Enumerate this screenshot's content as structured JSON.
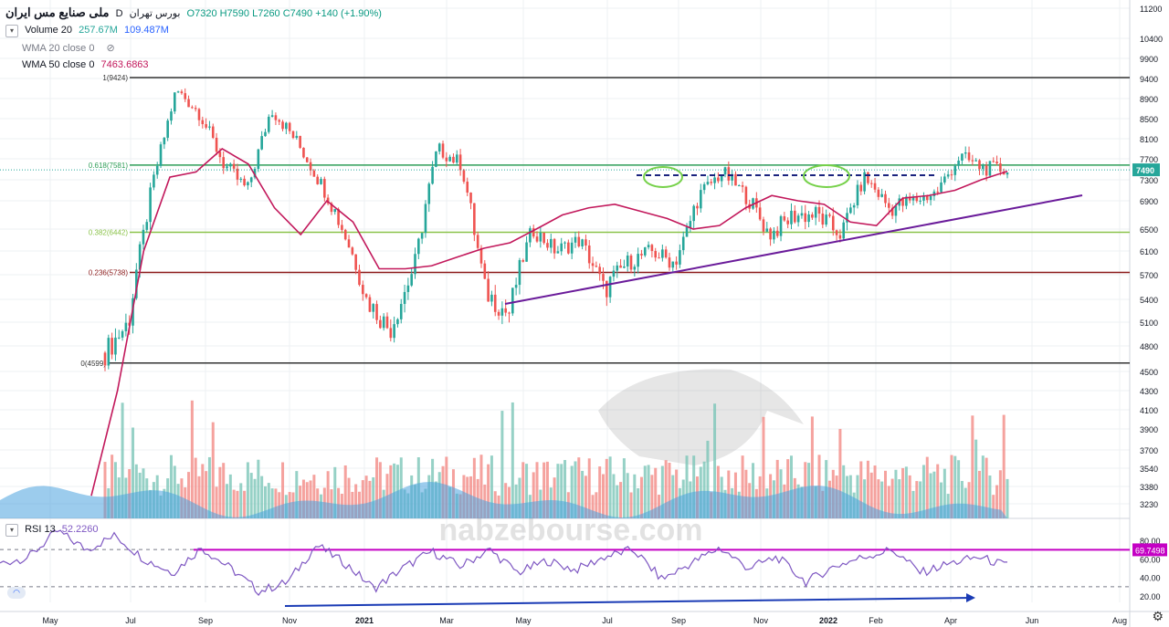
{
  "header": {
    "symbol": "ملی صنایع مس ایران",
    "interval": "D",
    "exchange": "بورس تهران",
    "ohlc": "O7320 H7590 L7260 C7490 +140 (+1.90%)"
  },
  "indicators": {
    "volume": {
      "label": "Volume 20",
      "v1": "257.67M",
      "v2": "109.487M"
    },
    "wma20": {
      "label": "WMA 20 close 0"
    },
    "wma50": {
      "label": "WMA 50 close 0",
      "value": "7463.6863"
    },
    "rsi": {
      "label": "RSI 13",
      "value": "52.2260"
    }
  },
  "watermark": {
    "text": "nabzebourse.com"
  },
  "colors": {
    "up": "#26a69a",
    "down": "#ef5350",
    "wma": "#c2185b",
    "fib_1": "#333333",
    "fib_618": "#2e9e57",
    "fib_382": "#8bc34a",
    "fib_236": "#8b1a1a",
    "fib_0": "#333333",
    "trend": "#6a1b9a",
    "rsi": "#7e57c2",
    "rsi_level": "#c400c4",
    "rsi_div": "#1a3bb5"
  },
  "chart_data": {
    "type": "line",
    "title": "ملی صنایع مس ایران · D · بورس تهران",
    "x": [
      "May",
      "Jul",
      "Sep",
      "Nov",
      "2021",
      "Mar",
      "May",
      "Jul",
      "Sep",
      "Nov",
      "2022",
      "Feb",
      "Apr",
      "Jun",
      "Aug"
    ],
    "y_ticks": [
      11200,
      10400,
      9900,
      9400,
      8900,
      8500,
      8100,
      7700,
      7300,
      6900,
      6500,
      6100,
      5700,
      5400,
      5100,
      4800,
      4500,
      4300,
      4100,
      3900,
      3700,
      3540,
      3380,
      3230
    ],
    "last_price": 7490,
    "fib_levels": [
      {
        "label": "1(9424)",
        "value": 9424
      },
      {
        "label": "0.618(7581)",
        "value": 7581
      },
      {
        "label": "0.382(6442)",
        "value": 6442
      },
      {
        "label": "0.236(5738)",
        "value": 5738
      },
      {
        "label": "0(4599)",
        "value": 4599
      }
    ],
    "series": [
      {
        "name": "Price",
        "values": [
          4720,
          5100,
          7200,
          9100,
          8600,
          7600,
          7100,
          8700,
          8100,
          7300,
          6500,
          5400,
          5000,
          5800,
          7900,
          7600,
          5500,
          5200,
          6500,
          6100,
          6300,
          5500,
          5900,
          6100,
          5900,
          7000,
          7450,
          7000,
          6400,
          6700,
          6700,
          6400,
          7350,
          6800,
          6900,
          7050,
          7750,
          7520,
          7490
        ]
      },
      {
        "name": "WMA 50",
        "values": [
          3300,
          4300,
          6100,
          7350,
          7450,
          7900,
          7600,
          6800,
          6400,
          6900,
          6600,
          5800,
          5800,
          5850,
          6000,
          6150,
          6250,
          6500,
          6700,
          6800,
          6850,
          6750,
          6650,
          6500,
          6550,
          6800,
          7000,
          6900,
          6850,
          6600,
          6550,
          6950,
          7000,
          7100,
          7300,
          7463.6863
        ]
      },
      {
        "name": "RSI 13",
        "values": [
          55,
          62,
          90,
          70,
          85,
          60,
          45,
          72,
          50,
          25,
          35,
          75,
          55,
          28,
          50,
          68,
          52,
          70,
          45,
          58,
          48,
          62,
          70,
          38,
          55,
          72,
          50,
          62,
          35,
          52,
          62,
          70,
          45,
          55,
          62,
          52.226
        ]
      }
    ],
    "rsi_ticks": [
      80,
      60,
      40,
      20
    ],
    "rsi_level": 69.7498,
    "rsi_level_label": "69.7498",
    "annotations": [
      "ascending trendline",
      "resistance at 7581",
      "RSI bullish divergence"
    ]
  }
}
